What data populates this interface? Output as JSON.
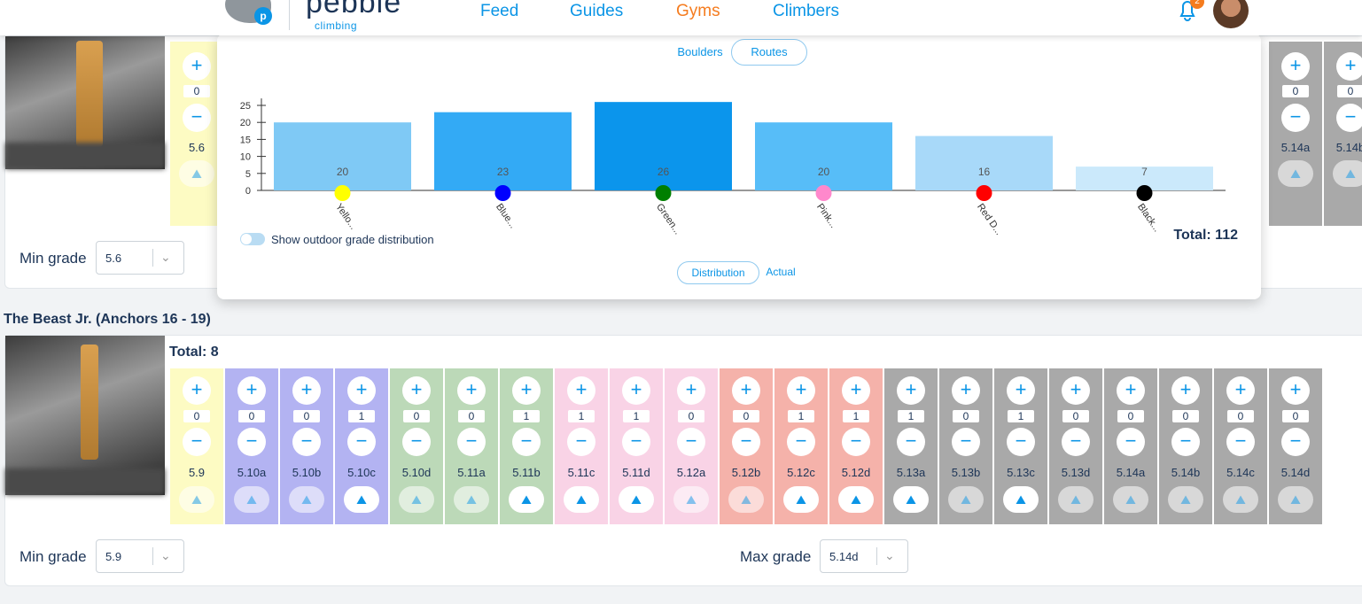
{
  "header": {
    "logo_word": "pebble",
    "logo_sub": "climbing",
    "logo_badge": "p",
    "nav": [
      "Feed",
      "Guides",
      "Gyms",
      "Climbers"
    ],
    "active_nav": "Gyms",
    "notification_count": "2"
  },
  "popup": {
    "tabs": [
      "Boulders",
      "Routes"
    ],
    "selected_tab": "Routes",
    "toggle_label": "Show outdoor grade distribution",
    "total": "Total: 112",
    "view_tabs": [
      "Distribution",
      "Actual"
    ],
    "selected_view": "Distribution"
  },
  "chart_data": {
    "type": "bar",
    "categories": [
      "Yello...",
      "Blue...",
      "Green...",
      "Pink...",
      "Red D...",
      "Black..."
    ],
    "values": [
      20,
      23,
      26,
      20,
      16,
      7
    ],
    "dot_colors": [
      "#ffff00",
      "#0000ff",
      "#007f00",
      "#ff88cc",
      "#ff0000",
      "#000000"
    ],
    "bar_colors": [
      "#7fc9f5",
      "#33aaf5",
      "#0b95ec",
      "#57bdf8",
      "#a8d9f9",
      "#cbe9fb"
    ],
    "yticks": [
      0,
      5,
      10,
      15,
      20,
      25
    ],
    "ylim": [
      0,
      26
    ],
    "title": "",
    "xlabel": "",
    "ylabel": ""
  },
  "card1": {
    "visible_left_column": {
      "count": "0",
      "grade": "5.6"
    },
    "visible_right_columns": [
      {
        "count": "0",
        "grade": "5.14a"
      },
      {
        "count": "0",
        "grade": "5.14b"
      }
    ],
    "min_grade_label": "Min grade",
    "min_grade_value": "5.6"
  },
  "card2": {
    "title": "The Beast Jr. (Anchors 16 - 19)",
    "total": "Total: 8",
    "columns": [
      {
        "grade": "5.9",
        "count": "0",
        "color": "#fdfbc3",
        "active": false
      },
      {
        "grade": "5.10a",
        "count": "0",
        "color": "#b3b3f2",
        "active": false
      },
      {
        "grade": "5.10b",
        "count": "0",
        "color": "#b3b3f2",
        "active": false
      },
      {
        "grade": "5.10c",
        "count": "1",
        "color": "#b3b3f2",
        "active": true
      },
      {
        "grade": "5.10d",
        "count": "0",
        "color": "#bcd9b8",
        "active": false
      },
      {
        "grade": "5.11a",
        "count": "0",
        "color": "#bcd9b8",
        "active": false
      },
      {
        "grade": "5.11b",
        "count": "1",
        "color": "#bcd9b8",
        "active": true
      },
      {
        "grade": "5.11c",
        "count": "1",
        "color": "#f9d3e6",
        "active": true
      },
      {
        "grade": "5.11d",
        "count": "1",
        "color": "#f9d3e6",
        "active": true
      },
      {
        "grade": "5.12a",
        "count": "0",
        "color": "#f9d3e6",
        "active": false
      },
      {
        "grade": "5.12b",
        "count": "0",
        "color": "#f5b2aa",
        "active": false
      },
      {
        "grade": "5.12c",
        "count": "1",
        "color": "#f5b2aa",
        "active": true
      },
      {
        "grade": "5.12d",
        "count": "1",
        "color": "#f5b2aa",
        "active": true
      },
      {
        "grade": "5.13a",
        "count": "1",
        "color": "#a9a9a9",
        "active": true
      },
      {
        "grade": "5.13b",
        "count": "0",
        "color": "#a9a9a9",
        "active": false
      },
      {
        "grade": "5.13c",
        "count": "1",
        "color": "#a9a9a9",
        "active": true
      },
      {
        "grade": "5.13d",
        "count": "0",
        "color": "#a9a9a9",
        "active": false
      },
      {
        "grade": "5.14a",
        "count": "0",
        "color": "#a9a9a9",
        "active": false
      },
      {
        "grade": "5.14b",
        "count": "0",
        "color": "#a9a9a9",
        "active": false
      },
      {
        "grade": "5.14c",
        "count": "0",
        "color": "#a9a9a9",
        "active": false
      },
      {
        "grade": "5.14d",
        "count": "0",
        "color": "#a9a9a9",
        "active": false
      }
    ],
    "min_grade_label": "Min grade",
    "min_grade_value": "5.9",
    "max_grade_label": "Max grade",
    "max_grade_value": "5.14d"
  },
  "icons": {
    "plus": "+",
    "minus": "−",
    "chevron": "⌄",
    "send": "⛰"
  }
}
